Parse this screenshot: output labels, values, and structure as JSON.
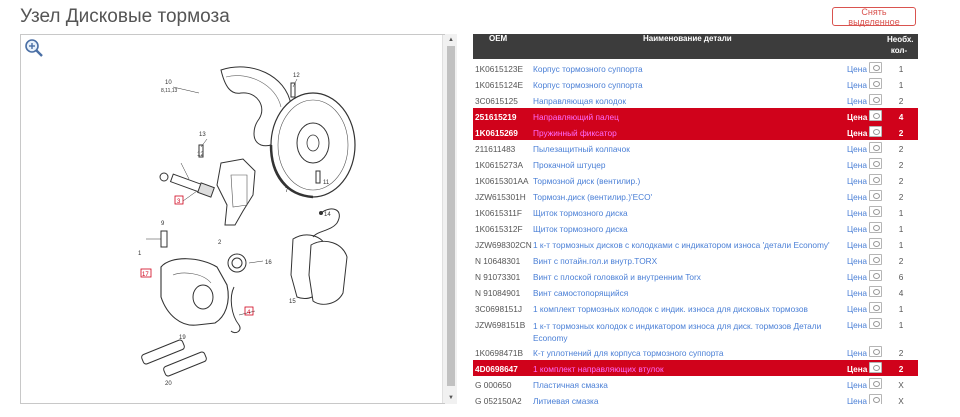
{
  "page": {
    "title": "Узел Дисковые тормоза",
    "clear_button": "Снять выделенное"
  },
  "diagram": {
    "labels": [
      "10",
      "8,11,13",
      "12",
      "13",
      "12",
      "3",
      "9",
      "7",
      "11",
      "14",
      "1",
      "2",
      "16",
      "15",
      "17",
      "4",
      "19",
      "20"
    ]
  },
  "table": {
    "headers": {
      "oem": "OEM",
      "name": "Наименование детали",
      "qty_line1": "Необх.",
      "qty_line2": "кол-во"
    },
    "rows": [
      {
        "oem": "1K0615123E",
        "name": "Корпус тормозного суппорта",
        "price": "Цена",
        "qty": "1",
        "selected": false
      },
      {
        "oem": "1K0615124E",
        "name": "Корпус тормозного суппорта",
        "price": "Цена",
        "qty": "1",
        "selected": false
      },
      {
        "oem": "3C0615125",
        "name": "Направляющая колодок",
        "price": "Цена",
        "qty": "2",
        "selected": false
      },
      {
        "oem": "251615219",
        "name": "Направляющий палец",
        "price": "Цена",
        "qty": "4",
        "selected": true
      },
      {
        "oem": "1K0615269",
        "name": "Пружинный фиксатор",
        "price": "Цена",
        "qty": "2",
        "selected": true
      },
      {
        "oem": "211611483",
        "name": "Пылезащитный колпачок",
        "price": "Цена",
        "qty": "2",
        "selected": false
      },
      {
        "oem": "1K0615273A",
        "name": "Прокачной штуцер",
        "price": "Цена",
        "qty": "2",
        "selected": false
      },
      {
        "oem": "1K0615301AA",
        "name": "Тормозной диск (вентилир.)",
        "price": "Цена",
        "qty": "2",
        "selected": false
      },
      {
        "oem": "JZW615301H",
        "name": "Тормозн.диск (вентилир.)'ECO'",
        "price": "Цена",
        "qty": "2",
        "selected": false
      },
      {
        "oem": "1K0615311F",
        "name": "Щиток тормозного диска",
        "price": "Цена",
        "qty": "1",
        "selected": false
      },
      {
        "oem": "1K0615312F",
        "name": "Щиток тормозного диска",
        "price": "Цена",
        "qty": "1",
        "selected": false
      },
      {
        "oem": "JZW698302CN",
        "name": "1 к-т тормозных дисков с колодками с индикатором износа 'детали Economy'",
        "price": "Цена",
        "qty": "1",
        "selected": false
      },
      {
        "oem": "N 10648301",
        "name": "Винт с потайн.гол.и внутр.TORX",
        "price": "Цена",
        "qty": "2",
        "selected": false
      },
      {
        "oem": "N 91073301",
        "name": "Винт с плоской головкой и внутренним Torx",
        "price": "Цена",
        "qty": "6",
        "selected": false
      },
      {
        "oem": "N 91084901",
        "name": "Винт самостопорящийся",
        "price": "Цена",
        "qty": "4",
        "selected": false
      },
      {
        "oem": "3C0698151J",
        "name": "1 комплект тормозных колодок с индик. износа для дисковых тормозов",
        "price": "Цена",
        "qty": "1",
        "selected": false
      },
      {
        "oem": "JZW698151B",
        "name": "1 к-т тормозных колодок с индикатором износа для диск. тормозов Детали Economy",
        "price": "Цена",
        "qty": "1",
        "selected": false
      },
      {
        "oem": "1K0698471B",
        "name": "К-т уплотнений для корпуса тормозного суппорта",
        "price": "Цена",
        "qty": "2",
        "selected": false
      },
      {
        "oem": "4D0698647",
        "name": "1 комплект направляющих втулок",
        "price": "Цена",
        "qty": "2",
        "selected": true
      },
      {
        "oem": "G 000650",
        "name": "Пластичная смазка",
        "price": "Цена",
        "qty": "X",
        "selected": false
      },
      {
        "oem": "G 052150A2",
        "name": "Литиевая смазка",
        "price": "Цена",
        "qty": "X",
        "selected": false
      }
    ]
  },
  "colors": {
    "selected_row": "#d0021b",
    "link": "#4a7fd6",
    "header_bg": "#3c3c3c"
  }
}
